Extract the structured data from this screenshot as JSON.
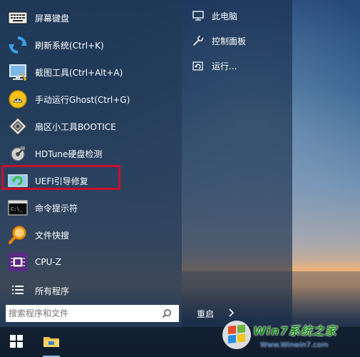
{
  "start_menu": {
    "programs": [
      {
        "label": "屏幕键盘",
        "icon": "keyboard-icon"
      },
      {
        "label": "刷新系统(Ctrl+K)",
        "icon": "refresh-icon"
      },
      {
        "label": "截图工具(Ctrl+Alt+A)",
        "icon": "screenshot-icon"
      },
      {
        "label": "手动运行Ghost(Ctrl+G)",
        "icon": "ghost-icon"
      },
      {
        "label": "扇区小工具BOOTICE",
        "icon": "disk-tool-icon"
      },
      {
        "label": "HDTune硬盘检测",
        "icon": "hdtune-icon"
      },
      {
        "label": "UEFI引导修复",
        "icon": "uefi-repair-icon"
      },
      {
        "label": "命令提示符",
        "icon": "cmd-icon"
      },
      {
        "label": "文件快搜",
        "icon": "search-file-icon"
      },
      {
        "label": "CPU-Z",
        "icon": "cpuz-icon"
      }
    ],
    "all_programs_label": "所有程序",
    "places": [
      {
        "label": "此电脑",
        "icon": "computer-icon"
      },
      {
        "label": "控制面板",
        "icon": "wrench-icon"
      },
      {
        "label": "运行...",
        "icon": "run-icon"
      }
    ],
    "search": {
      "placeholder": "搜索程序和文件"
    },
    "restart": {
      "label": "重启"
    }
  },
  "watermark": {
    "title": "Win7系统之家",
    "url": "Www.Winwin7.com"
  },
  "colors": {
    "highlight": "#c8102e",
    "accent": "#2d7dd2"
  }
}
